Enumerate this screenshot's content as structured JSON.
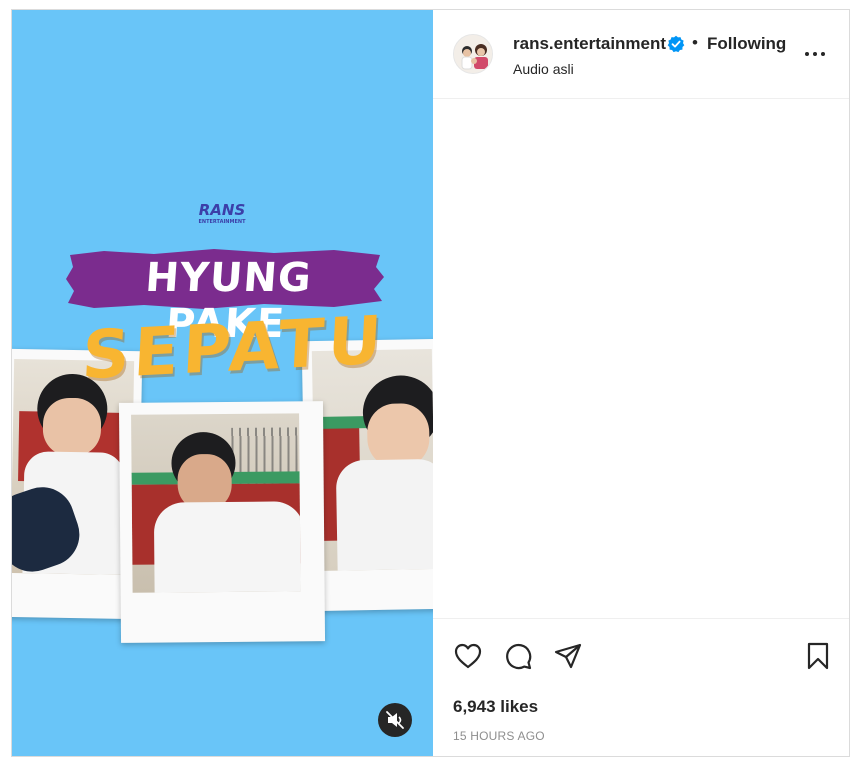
{
  "post": {
    "username": "rans.entertainment",
    "separator": "•",
    "follow_status": "Following",
    "audio_label": "Audio asli",
    "likes": "6,943 likes",
    "timestamp": "15 HOURS AGO"
  },
  "media": {
    "logo_text": "RANS",
    "logo_subtext": "ENTERTAINMENT",
    "headline_line1": "HYUNG PAKE",
    "headline_line2": "SEPATU"
  },
  "icons": {
    "verified": "verified-badge-icon",
    "more": "more-options-icon",
    "like": "heart-icon",
    "comment": "comment-icon",
    "share": "share-icon",
    "save": "bookmark-icon",
    "mute": "muted-speaker-icon"
  },
  "colors": {
    "media_background": "#69c5f8",
    "banner_purple": "#7b2c8e",
    "headline_orange": "#f8b531",
    "verified_blue": "#0095f6",
    "text_primary": "#262626",
    "text_secondary": "#8e8e8e"
  }
}
